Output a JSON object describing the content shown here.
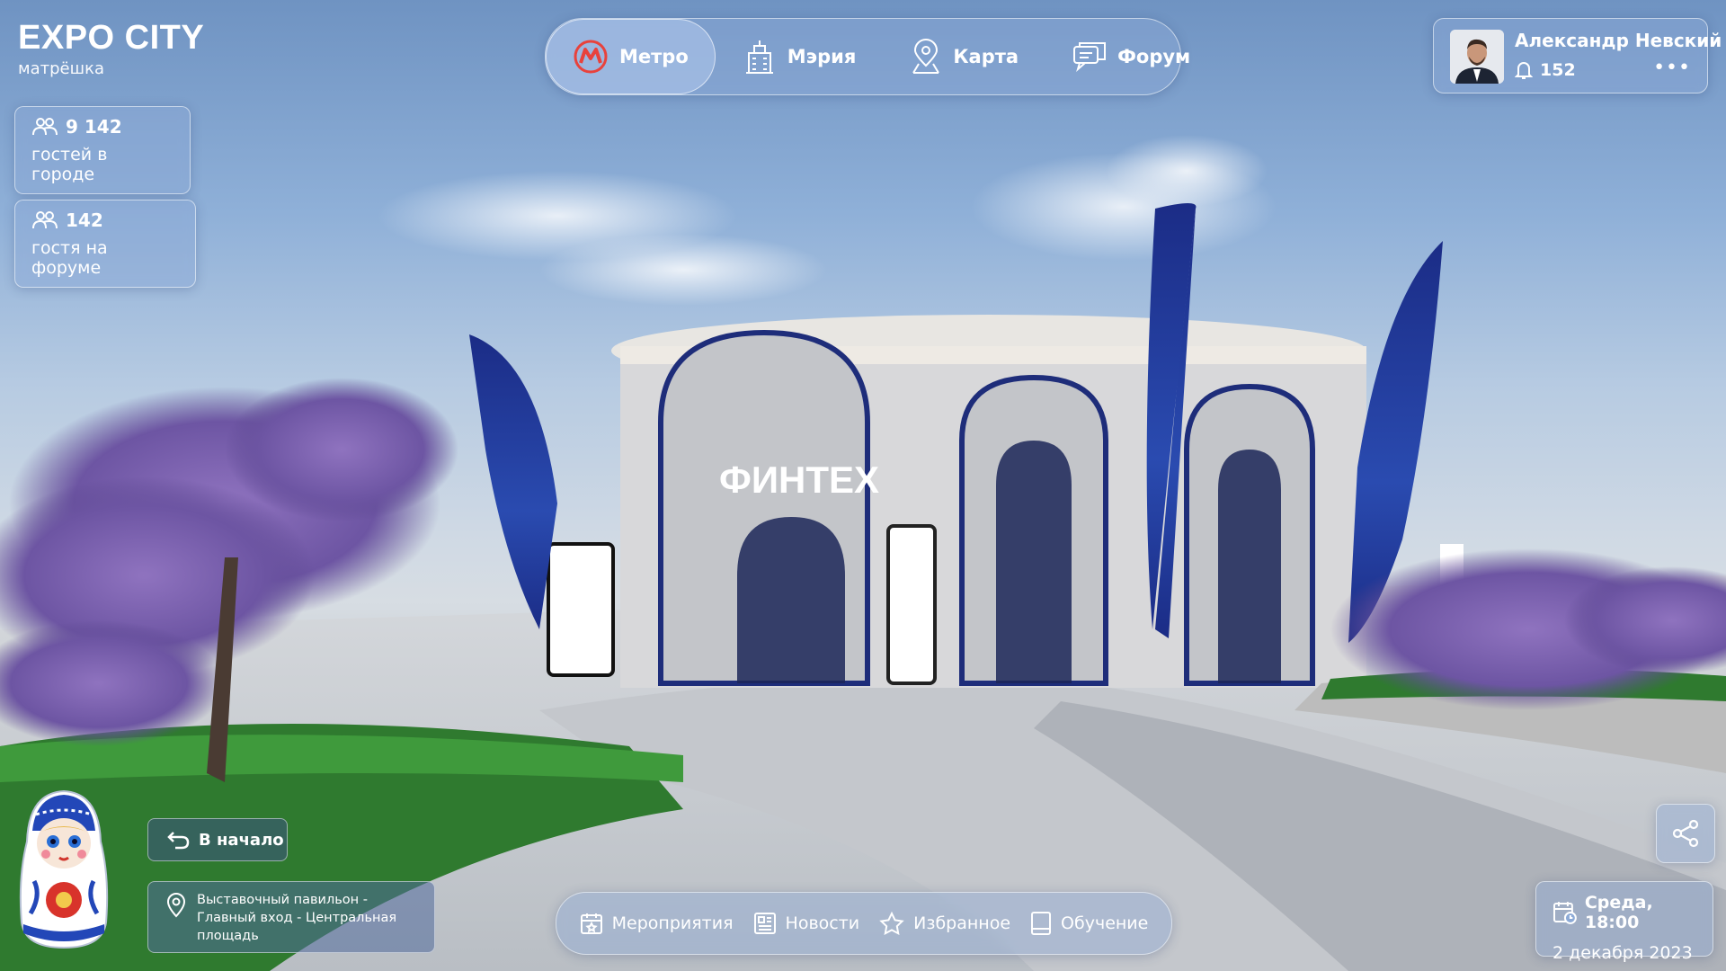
{
  "brand": {
    "title": "EXPO CITY",
    "subtitle": "матрёшка"
  },
  "stats": [
    {
      "count": "9 142",
      "label": "гостей в городе",
      "icon": "users-icon"
    },
    {
      "count": "142",
      "label": "гостя на форуме",
      "icon": "users-icon"
    }
  ],
  "nav": {
    "items": [
      {
        "label": "Метро",
        "icon": "metro-icon",
        "active": true
      },
      {
        "label": "Мэрия",
        "icon": "city-hall-icon",
        "active": false
      },
      {
        "label": "Карта",
        "icon": "map-pin-icon",
        "active": false
      },
      {
        "label": "Форум",
        "icon": "chat-icon",
        "active": false
      }
    ]
  },
  "user": {
    "name": "Александр Невский",
    "notifications": "152",
    "more_icon": "more-icon"
  },
  "scene": {
    "building_sign": "ФИНТЕХ"
  },
  "home_button": {
    "label": "В начало",
    "icon": "back-arrow-icon"
  },
  "location": {
    "text": "Выставочный павильон - Главный вход - Центральная площадь",
    "icon": "location-pin-icon"
  },
  "bottom_nav": {
    "items": [
      {
        "label": "Мероприятия",
        "icon": "calendar-icon"
      },
      {
        "label": "Новости",
        "icon": "news-icon"
      },
      {
        "label": "Избранное",
        "icon": "star-icon"
      },
      {
        "label": "Обучение",
        "icon": "book-icon"
      }
    ]
  },
  "datetime": {
    "day_time": "Среда, 18:00",
    "date": "2 декабря 2023",
    "icon": "calendar-clock-icon"
  },
  "share": {
    "icon": "share-icon"
  },
  "colors": {
    "metro_red": "#e8423c",
    "panel": "#8caad7",
    "accent_blue": "#1e3a8a"
  }
}
